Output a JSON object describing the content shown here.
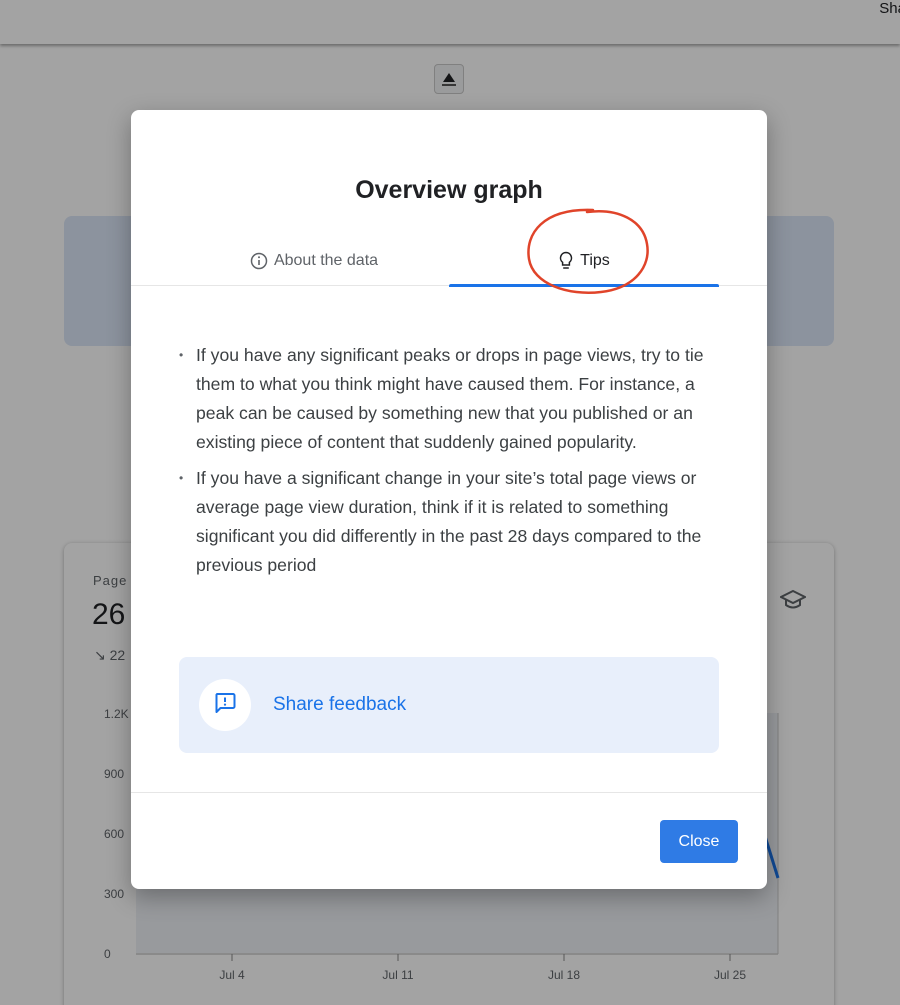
{
  "background": {
    "topbar": {
      "share_label": "Sha"
    },
    "card": {
      "title": "Page",
      "value": "26",
      "trend": "22",
      "y_ticks": [
        "0",
        "300",
        "600",
        "900",
        "1.2K"
      ],
      "x_ticks": [
        "Jul 4",
        "Jul 11",
        "Jul 18",
        "Jul 25"
      ]
    }
  },
  "modal": {
    "title": "Overview graph",
    "tabs": [
      {
        "label": "About the data",
        "icon": "info-icon",
        "active": false
      },
      {
        "label": "Tips",
        "icon": "lightbulb-icon",
        "active": true
      }
    ],
    "tips": [
      "If you have any significant peaks or drops in page views, try to tie them to what you think might have caused them. For instance, a peak can be caused by something new that you published or an existing piece of content that suddenly gained popularity.",
      "If you have a significant change in your site’s total page views or average page view duration, think if it is related to something significant you did differently in the past 28 days compared to the previous period"
    ],
    "feedback": {
      "label": "Share feedback",
      "icon": "feedback-icon"
    },
    "close_label": "Close"
  },
  "colors": {
    "accent": "#1a73e8",
    "button": "#2f7be5",
    "annotation": "#e0442a",
    "feedback_bg": "#e8effb"
  }
}
